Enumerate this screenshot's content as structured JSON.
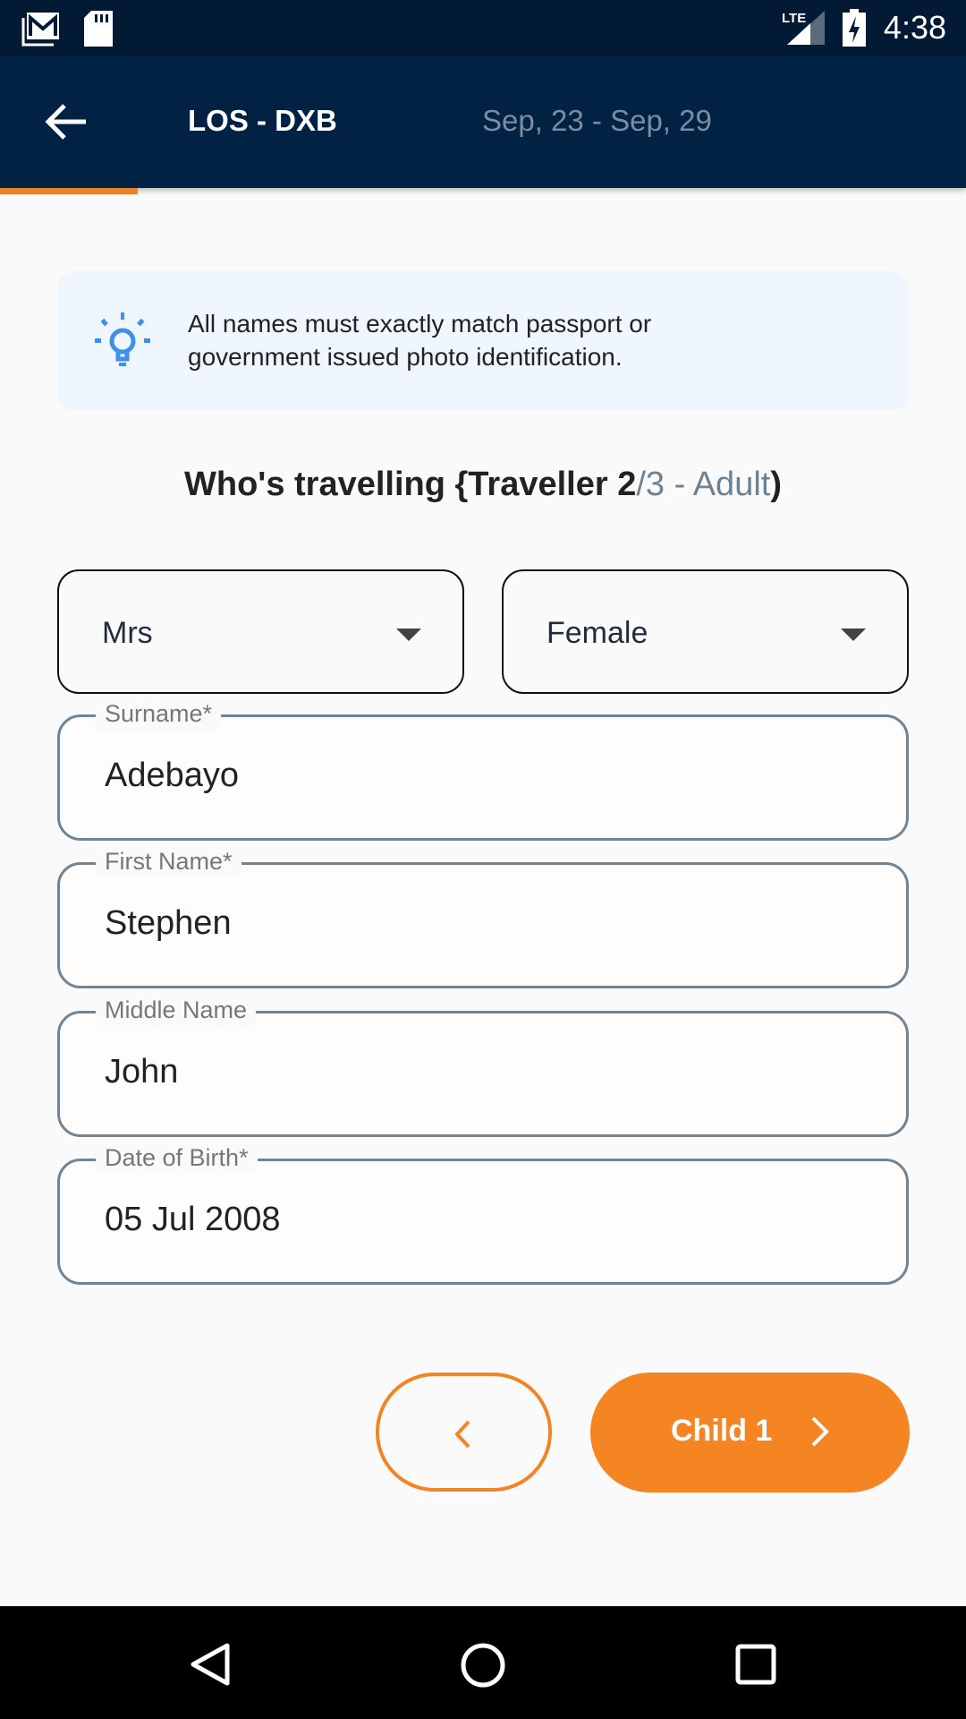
{
  "status_bar": {
    "time": "4:38",
    "network": "LTE",
    "icons": [
      "gmail-icon",
      "sd-card-icon",
      "signal-icon",
      "battery-charging-icon"
    ]
  },
  "app_bar": {
    "title": "LOS - DXB",
    "dates": "Sep, 23 - Sep, 29",
    "progress_percent": 14
  },
  "info": {
    "icon": "lightbulb-icon",
    "text_line1": "All names must exactly match passport or",
    "text_line2": "government issued photo identification."
  },
  "heading": {
    "main": "Who's travelling {Traveller 2",
    "sub": "/3 - Adult",
    ")": ")",
    "close": ")"
  },
  "form": {
    "title_select": {
      "value": "Mrs"
    },
    "gender_select": {
      "value": "Female"
    },
    "fields": [
      {
        "label": "Surname*",
        "value": "Adebayo"
      },
      {
        "label": "First Name*",
        "value": "Stephen"
      },
      {
        "label": "Middle Name",
        "value": "John"
      },
      {
        "label": "Date of Birth*",
        "value": "05 Jul 2008"
      }
    ]
  },
  "buttons": {
    "next_label": "Child 1"
  },
  "colors": {
    "accent": "#f58523",
    "appbar": "#022244",
    "info_bg": "#eff6fe",
    "icon_blue": "#3d8fe8"
  }
}
